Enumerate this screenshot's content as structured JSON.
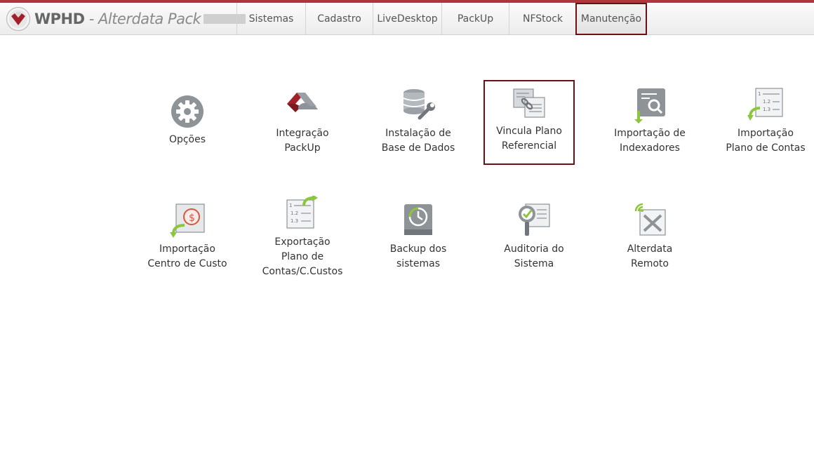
{
  "app": {
    "title_bold": "WPHD",
    "title_rest": " - Alterdata Pack",
    "logo_icon": "alterdata-logo-icon"
  },
  "nav": {
    "tabs": [
      {
        "label": "Sistemas"
      },
      {
        "label": "Cadastro"
      },
      {
        "label": "LiveDesktop"
      },
      {
        "label": "PackUp"
      },
      {
        "label": "NFStock"
      },
      {
        "label": "Manutenção",
        "active": true
      }
    ]
  },
  "tiles": [
    {
      "label": "Opções",
      "icon": "gear-icon"
    },
    {
      "label": "Integração\nPackUp",
      "icon": "packup-integration-icon"
    },
    {
      "label": "Instalação de\nBase de Dados",
      "icon": "database-wrench-icon"
    },
    {
      "label": "Vincula Plano\nReferencial",
      "icon": "link-documents-icon",
      "selected": true
    },
    {
      "label": "Importação de\nIndexadores",
      "icon": "import-indexers-icon"
    },
    {
      "label": "Importação\nPlano de Contas",
      "icon": "import-chart-of-accounts-icon"
    },
    {
      "label": "Importação\nCentro de Custo",
      "icon": "import-cost-center-icon"
    },
    {
      "label": "Exportação\nPlano de\nContas/C.Custos",
      "icon": "export-chart-of-accounts-icon"
    },
    {
      "label": "Backup dos\nsistemas",
      "icon": "backup-icon"
    },
    {
      "label": "Auditoria do\nSistema",
      "icon": "audit-icon"
    },
    {
      "label": "Alterdata\nRemoto",
      "icon": "remote-access-icon"
    }
  ],
  "colors": {
    "accent": "#6e0f16",
    "brand_red": "#b0363d",
    "icon_green": "#8cc63f",
    "icon_gray": "#8e9398"
  }
}
